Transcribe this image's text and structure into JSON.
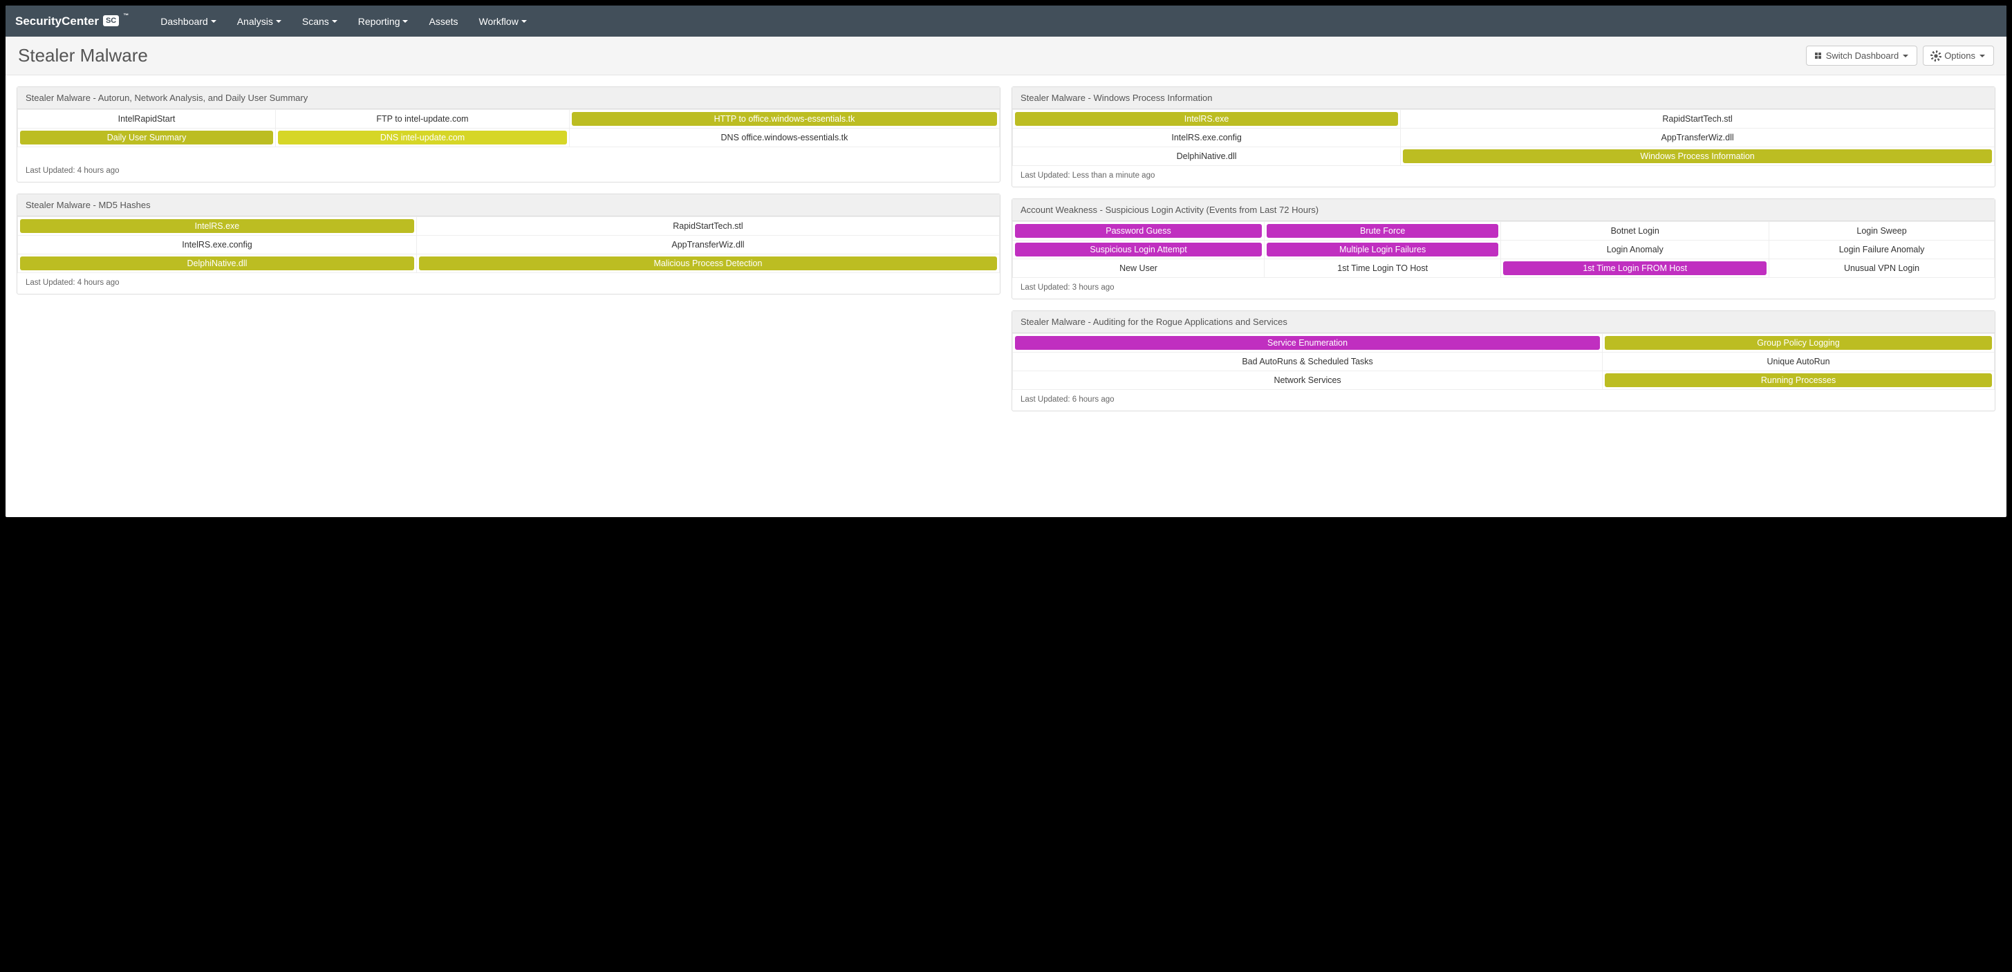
{
  "brand": {
    "name": "SecurityCenter",
    "badge": "SC",
    "tm": "™"
  },
  "nav": [
    {
      "label": "Dashboard",
      "hasCaret": true
    },
    {
      "label": "Analysis",
      "hasCaret": true
    },
    {
      "label": "Scans",
      "hasCaret": true
    },
    {
      "label": "Reporting",
      "hasCaret": true
    },
    {
      "label": "Assets",
      "hasCaret": false
    },
    {
      "label": "Workflow",
      "hasCaret": true
    }
  ],
  "page_title": "Stealer Malware",
  "buttons": {
    "switch": "Switch Dashboard",
    "options": "Options"
  },
  "panels": {
    "autorun": {
      "title": "Stealer Malware - Autorun, Network Analysis, and Daily User Summary",
      "rows": [
        [
          {
            "label": "IntelRapidStart",
            "style": "plain"
          },
          {
            "label": "FTP to intel-update.com",
            "style": "plain"
          },
          {
            "label": "HTTP to office.windows-essentials.tk",
            "style": "olive"
          }
        ],
        [
          {
            "label": "Daily User Summary",
            "style": "olive"
          },
          {
            "label": "DNS intel-update.com",
            "style": "yellow"
          },
          {
            "label": "DNS office.windows-essentials.tk",
            "style": "plain"
          }
        ]
      ],
      "footer": "Last Updated: 4 hours ago"
    },
    "md5": {
      "title": "Stealer Malware - MD5 Hashes",
      "rows": [
        [
          {
            "label": "IntelRS.exe",
            "style": "olive"
          },
          {
            "label": "RapidStartTech.stl",
            "style": "plain"
          }
        ],
        [
          {
            "label": "IntelRS.exe.config",
            "style": "plain"
          },
          {
            "label": "AppTransferWiz.dll",
            "style": "plain"
          }
        ],
        [
          {
            "label": "DelphiNative.dll",
            "style": "olive"
          },
          {
            "label": "Malicious Process Detection",
            "style": "olive"
          }
        ]
      ],
      "footer": "Last Updated: 4 hours ago"
    },
    "wpi": {
      "title": "Stealer Malware - Windows Process Information",
      "rows": [
        [
          {
            "label": "IntelRS.exe",
            "style": "olive"
          },
          {
            "label": "RapidStartTech.stl",
            "style": "plain"
          }
        ],
        [
          {
            "label": "IntelRS.exe.config",
            "style": "plain"
          },
          {
            "label": "AppTransferWiz.dll",
            "style": "plain"
          }
        ],
        [
          {
            "label": "DelphiNative.dll",
            "style": "plain"
          },
          {
            "label": "Windows Process Information",
            "style": "olive"
          }
        ]
      ],
      "footer": "Last Updated: Less than a minute ago"
    },
    "account": {
      "title": "Account Weakness - Suspicious Login Activity (Events from Last 72 Hours)",
      "rows": [
        [
          {
            "label": "Password Guess",
            "style": "purple"
          },
          {
            "label": "Brute Force",
            "style": "purple"
          },
          {
            "label": "Botnet Login",
            "style": "plain"
          },
          {
            "label": "Login Sweep",
            "style": "plain"
          }
        ],
        [
          {
            "label": "Suspicious Login Attempt",
            "style": "purple"
          },
          {
            "label": "Multiple Login Failures",
            "style": "purple"
          },
          {
            "label": "Login Anomaly",
            "style": "plain"
          },
          {
            "label": "Login Failure Anomaly",
            "style": "plain"
          }
        ],
        [
          {
            "label": "New User",
            "style": "plain"
          },
          {
            "label": "1st Time Login TO Host",
            "style": "plain"
          },
          {
            "label": "1st Time Login FROM Host",
            "style": "purple"
          },
          {
            "label": "Unusual VPN Login",
            "style": "plain"
          }
        ]
      ],
      "footer": "Last Updated: 3 hours ago"
    },
    "rogue": {
      "title": "Stealer Malware - Auditing for the Rogue Applications and Services",
      "rows": [
        [
          {
            "label": "Service Enumeration",
            "style": "purple"
          },
          {
            "label": "Group Policy Logging",
            "style": "olive"
          }
        ],
        [
          {
            "label": "Bad AutoRuns & Scheduled Tasks",
            "style": "plain"
          },
          {
            "label": "Unique AutoRun",
            "style": "plain"
          }
        ],
        [
          {
            "label": "Network Services",
            "style": "plain"
          },
          {
            "label": "Running Processes",
            "style": "olive"
          }
        ]
      ],
      "footer": "Last Updated: 6 hours ago"
    }
  }
}
